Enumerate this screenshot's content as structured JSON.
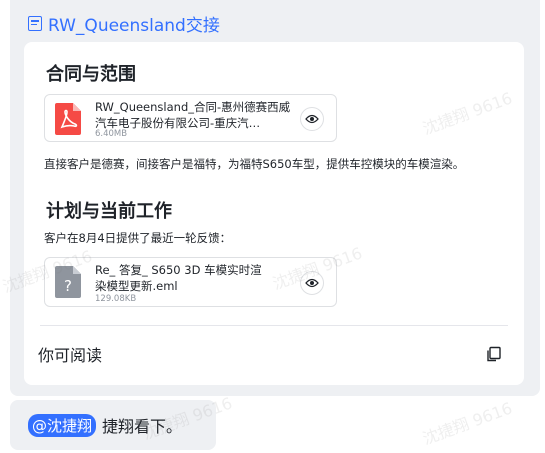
{
  "doc": {
    "title": "RW_Queensland交接",
    "icon": "doc-icon"
  },
  "sections": {
    "contract_heading": "合同与范围",
    "contract_file": {
      "name": "RW_Queensland_合同-惠州德赛西威汽车电子股份有限公司-重庆汽…",
      "size": "6.40MB",
      "icon": "pdf-icon"
    },
    "contract_text": "直接客户是德赛，间接客户是福特，为福特S650车型，提供车控模块的车模渲染。",
    "plan_heading": "计划与当前工作",
    "plan_text": "客户在8月4日提供了最近一轮反馈：",
    "plan_file": {
      "name": "Re_ 答复_ S650 3D 车模实时渲染模型更新.eml",
      "size": "129.08KB",
      "icon": "unknown-file-icon"
    }
  },
  "footer": {
    "read_label": "你可阅读",
    "copy_icon": "copy-icon"
  },
  "reply": {
    "mention": "@沈捷翔",
    "text": "捷翔看下。"
  },
  "watermark": "沈捷翔 9616",
  "colors": {
    "accent": "#3370ff",
    "pdf_red": "#f54a45",
    "bubble_bg": "#eef0f3"
  }
}
